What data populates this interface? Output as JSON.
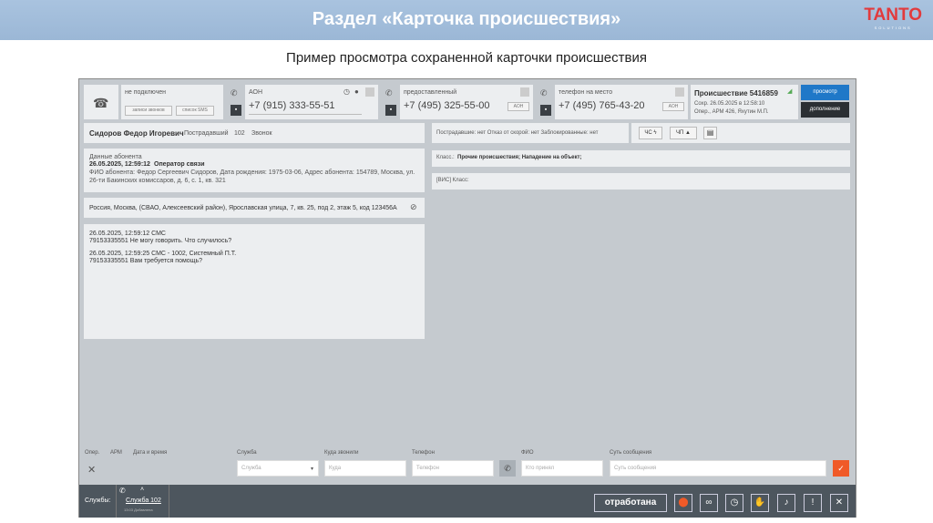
{
  "header": {
    "title": "Раздел «Карточка происшествия»",
    "logo": "TANTO",
    "logo_sub": "SOLUTIONS"
  },
  "subtitle": "Пример просмотра сохраненной карточки происшествия",
  "call": {
    "status": "не подключен",
    "btn_records": "записи звонков",
    "btn_sms": "список SMS"
  },
  "aon": {
    "label": "АОН",
    "number": "+7 (915) 333-55-51"
  },
  "provided": {
    "label": "предоставленный",
    "number": "+7 (495) 325-55-00",
    "btn": "АОН"
  },
  "onsite": {
    "label": "телефон на место",
    "number": "+7 (495) 765-43-20",
    "btn": "АОН"
  },
  "incident": {
    "title": "Происшествие 5416859",
    "saved": "Сохр. 26.05.2025 в 12:58:10",
    "operator": "Опер., АРМ 426, Яхутин М.П.",
    "btn_view": "просмотр",
    "btn_add": "дополнение"
  },
  "person": {
    "name": "Сидоров Федор Игоревич",
    "role": "Пострадавший",
    "num": "102",
    "type": "Звонок"
  },
  "subscriber": {
    "title": "Данные абонента",
    "datetime": "26.05.2025, 12:59:12",
    "source": "Оператор связи",
    "info": "ФИО абонента: Федор Сергеевич Сидоров, Дата рождения: 1975-03-06, Адрес абонента: 154789, Москва, ул. 26-ти Бакинских комиссаров, д. 6, с. 1, кв. 321"
  },
  "address": "Россия, Москва, (СВАО, Алексеевский район), Ярославская улица, 7, кв. 25, под 2, этаж 5, код 123456А",
  "messages": [
    {
      "head": "26.05.2025, 12:59:12    СМС",
      "text": "79153335551 Не могу говорить. Что случилось?"
    },
    {
      "head": "26.05.2025, 12:59:25    СМС - 1002, Системный П.Т.",
      "text": "79153335551 Вам требуется помощь?"
    }
  ],
  "flags": "Пострадавшие: нет   Отказ от скорой: нет   Заблокированные: нет",
  "badges": {
    "chs": "ЧС",
    "chp": "ЧП"
  },
  "class_label": "Класс.:",
  "class_value": "Прочие происшествия; Нападение на объект;",
  "vis_class": "[ВИС] Класс:",
  "form": {
    "oper": "Опер.",
    "arm": "АРМ",
    "datetime": "Дата и время",
    "service": "Служба",
    "service_ph": "Служба",
    "where": "Куда звонили",
    "where_ph": "Куда",
    "phone": "Телефон",
    "phone_ph": "Телефон",
    "fio": "ФИО",
    "fio_ph": "Кто принял",
    "msg": "Суть сообщения",
    "msg_ph": "Суть сообщения"
  },
  "footer": {
    "services": "Службы:",
    "service_tab": "Служба 102",
    "service_sub": "13:03 Добавлена",
    "done": "отработана"
  },
  "colors": {
    "accent": "#1f78c8",
    "orange": "#f05a28",
    "dark": "#4d565e"
  }
}
